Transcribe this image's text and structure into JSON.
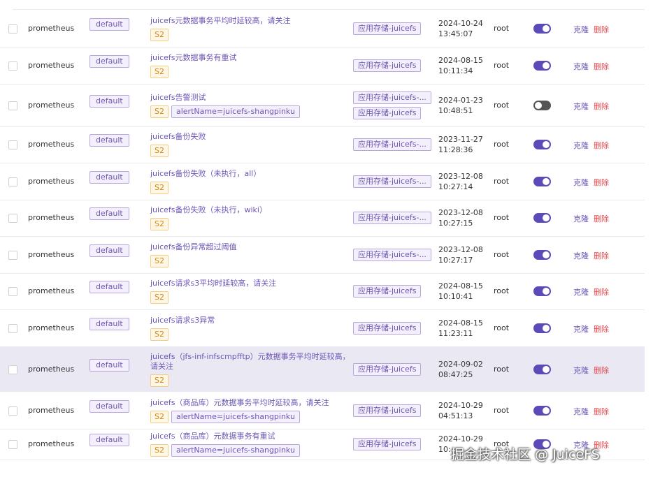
{
  "rows": [
    {
      "source": "prometheus",
      "namespace": "default",
      "title": "juicefs元数据事务平均时延较高，请关注",
      "severity": "S2",
      "labels": [],
      "groups": [
        "应用存储-juicefs"
      ],
      "time": "2024-10-24\n13:45:07",
      "user": "root",
      "enabled": true,
      "clone": "克隆",
      "delete": "删除"
    },
    {
      "source": "prometheus",
      "namespace": "default",
      "title": "juicefs元数据事务有重试",
      "severity": "S2",
      "labels": [],
      "groups": [
        "应用存储-juicefs"
      ],
      "time": "2024-08-15\n10:11:34",
      "user": "root",
      "enabled": true,
      "clone": "克隆",
      "delete": "删除"
    },
    {
      "source": "prometheus",
      "namespace": "default",
      "title": "juicefs告警测试",
      "severity": "S2",
      "labels": [
        "alertName=juicefs-shangpinku"
      ],
      "groups": [
        "应用存储-juicefs-...",
        "应用存储-juicefs"
      ],
      "time": "2024-01-23\n10:48:51",
      "user": "root",
      "enabled": false,
      "clone": "克隆",
      "delete": "删除"
    },
    {
      "source": "prometheus",
      "namespace": "default",
      "title": "juicefs备份失败",
      "severity": "S2",
      "labels": [],
      "groups": [
        "应用存储-juicefs-..."
      ],
      "time": "2023-11-27\n11:28:36",
      "user": "root",
      "enabled": true,
      "clone": "克隆",
      "delete": "删除"
    },
    {
      "source": "prometheus",
      "namespace": "default",
      "title": "juicefs备份失败（未执行，all）",
      "severity": "S2",
      "labels": [],
      "groups": [
        "应用存储-juicefs-..."
      ],
      "time": "2023-12-08\n10:27:14",
      "user": "root",
      "enabled": true,
      "clone": "克隆",
      "delete": "删除"
    },
    {
      "source": "prometheus",
      "namespace": "default",
      "title": "juicefs备份失败（未执行，wiki）",
      "severity": "S2",
      "labels": [],
      "groups": [
        "应用存储-juicefs-..."
      ],
      "time": "2023-12-08\n10:27:15",
      "user": "root",
      "enabled": true,
      "clone": "克隆",
      "delete": "删除"
    },
    {
      "source": "prometheus",
      "namespace": "default",
      "title": "juicefs备份异常超过阈值",
      "severity": "S2",
      "labels": [],
      "groups": [
        "应用存储-juicefs-..."
      ],
      "time": "2023-12-08\n10:27:17",
      "user": "root",
      "enabled": true,
      "clone": "克隆",
      "delete": "删除"
    },
    {
      "source": "prometheus",
      "namespace": "default",
      "title": "juicefs请求s3平均时延较高，请关注",
      "severity": "S2",
      "labels": [],
      "groups": [
        "应用存储-juicefs"
      ],
      "time": "2024-08-15\n10:10:41",
      "user": "root",
      "enabled": true,
      "clone": "克隆",
      "delete": "删除"
    },
    {
      "source": "prometheus",
      "namespace": "default",
      "title": "juicefs请求s3异常",
      "severity": "S2",
      "labels": [],
      "groups": [
        "应用存储-juicefs"
      ],
      "time": "2024-08-15\n11:23:11",
      "user": "root",
      "enabled": true,
      "clone": "克隆",
      "delete": "删除"
    },
    {
      "source": "prometheus",
      "namespace": "default",
      "title": "juicefs（jfs-inf-infscmpfftp）元数据事务平均时延较高，\n请关注",
      "severity": "S2",
      "labels": [],
      "groups": [
        "应用存储-juicefs"
      ],
      "time": "2024-09-02\n08:47:25",
      "user": "root",
      "enabled": true,
      "clone": "克隆",
      "delete": "删除",
      "highlight": true
    },
    {
      "source": "prometheus",
      "namespace": "default",
      "title": "juicefs（商品库）元数据事务平均时延较高，请关注",
      "severity": "S2",
      "labels": [
        "alertName=juicefs-shangpinku"
      ],
      "groups": [
        "应用存储-juicefs"
      ],
      "time": "2024-10-29\n04:51:13",
      "user": "root",
      "enabled": true,
      "clone": "克隆",
      "delete": "删除"
    },
    {
      "source": "prometheus",
      "namespace": "default",
      "title": "juicefs（商品库）元数据事务有重试",
      "severity": "S2",
      "labels": [
        "alertName=juicefs-shangpinku"
      ],
      "groups": [
        "应用存储-juicefs"
      ],
      "time": "2024-10-29\n10:...",
      "user": "root",
      "enabled": true,
      "clone": "克隆",
      "delete": "删除"
    }
  ],
  "watermark": "掘金技术社区 @ JuiceFS",
  "colors": {
    "accent": "#5b4bb8",
    "tag": "#6d56b6",
    "danger": "#e4464b",
    "severity": "#d48a15",
    "highlight": "#e9e8f3"
  }
}
